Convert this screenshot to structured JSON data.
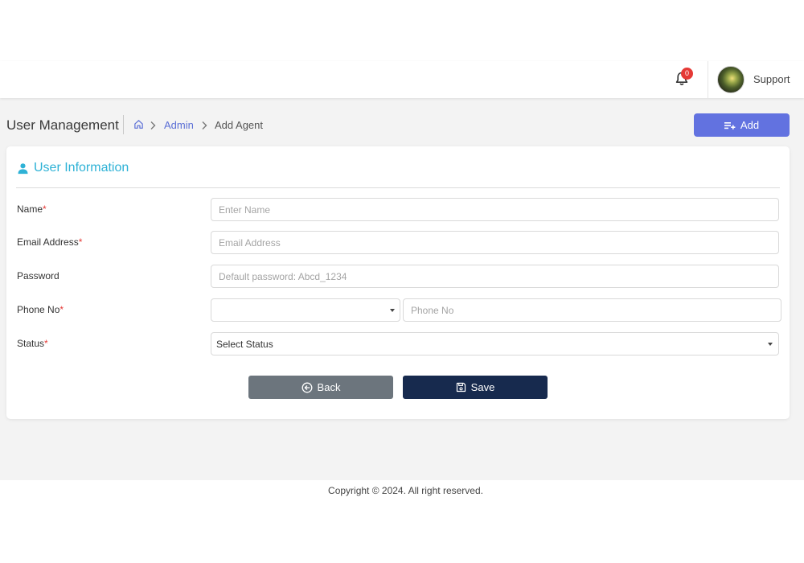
{
  "header": {
    "notification_count": "0",
    "user_name": "Support"
  },
  "page": {
    "title": "User Management",
    "breadcrumb": {
      "admin": "Admin",
      "current": "Add Agent"
    },
    "add_button_label": "Add"
  },
  "form": {
    "section_title": "User Information",
    "fields": {
      "name": {
        "label": "Name",
        "placeholder": "Enter Name",
        "value": ""
      },
      "email": {
        "label": "Email Address",
        "placeholder": "Email Address",
        "value": ""
      },
      "password": {
        "label": "Password",
        "placeholder": "Default password: Abcd_1234",
        "value": ""
      },
      "phone": {
        "label": "Phone No",
        "country_code_value": "",
        "placeholder": "Phone No",
        "value": ""
      },
      "status": {
        "label": "Status",
        "selected": "Select Status"
      }
    },
    "required_marker": "*",
    "back_label": "Back",
    "save_label": "Save"
  },
  "footer": {
    "copyright": "Copyright © 2024. All right reserved."
  },
  "colors": {
    "accent": "#6272e0",
    "section_title": "#2eb2d6",
    "save_button": "#172a4e",
    "back_button": "#6c757d",
    "badge": "#e53935",
    "required": "#e53935"
  },
  "icons": {
    "notification": "bell-icon",
    "breadcrumb_home": "home-icon",
    "breadcrumb_separator": "chevron-right-icon",
    "add": "playlist-add-icon",
    "section": "user-icon",
    "back": "arrow-circle-left-icon",
    "save": "floppy-disk-icon",
    "dropdown": "caret-down-icon"
  }
}
